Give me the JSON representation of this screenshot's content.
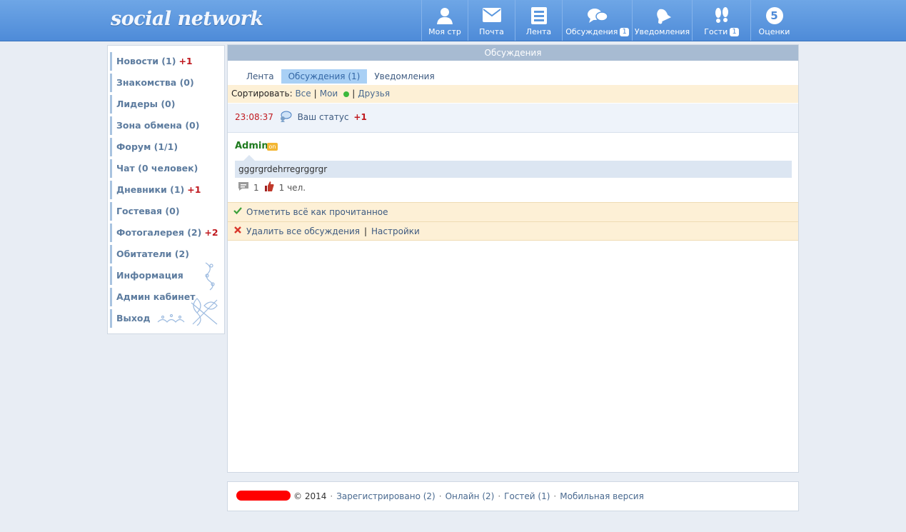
{
  "header": {
    "logo": "social network",
    "nav": [
      {
        "label": "Моя стр",
        "icon": "user-icon"
      },
      {
        "label": "Почта",
        "icon": "mail-icon"
      },
      {
        "label": "Лента",
        "icon": "feed-icon"
      },
      {
        "label": "Обсуждения",
        "icon": "discussions-icon",
        "badge": "1"
      },
      {
        "label": "Уведомления",
        "icon": "bell-icon"
      },
      {
        "label": "Гости",
        "icon": "footprints-icon",
        "badge": "1"
      },
      {
        "label": "Оценки",
        "icon": "rating-icon",
        "score": "5"
      }
    ]
  },
  "sidebar": {
    "items": [
      {
        "label": "Новости (1)",
        "plus": "+1"
      },
      {
        "label": "Знакомства (0)",
        "plus": ""
      },
      {
        "label": "Лидеры (0)",
        "plus": ""
      },
      {
        "label": "Зона обмена (0)",
        "plus": ""
      },
      {
        "label": "Форум (1/1)",
        "plus": ""
      },
      {
        "label": "Чат (0 человек)",
        "plus": ""
      },
      {
        "label": "Дневники (1)",
        "plus": "+1"
      },
      {
        "label": "Гостевая (0)",
        "plus": ""
      },
      {
        "label": "Фотогалерея (2)",
        "plus": "+2"
      },
      {
        "label": "Обитатели (2)",
        "plus": ""
      },
      {
        "label": "Информация",
        "plus": ""
      },
      {
        "label": "Админ кабинет",
        "plus": ""
      },
      {
        "label": "Выход",
        "plus": ""
      }
    ]
  },
  "main": {
    "title": "Обсуждения",
    "tabs": [
      "Лента",
      "Обсуждения (1)",
      "Уведомления"
    ],
    "sort": {
      "label": "Сортировать:",
      "all": "Все",
      "mine": "Мои",
      "friends": "Друзья"
    },
    "status": {
      "time": "23:08:37",
      "text": "Ваш статус",
      "plus": "+1"
    },
    "post": {
      "author": "Admin",
      "online_badge": "on",
      "message": "gggrgrdehrregrggrgr",
      "comments": "1",
      "likes": "1 чел."
    },
    "actions": {
      "mark_read": "Отметить всё как прочитанное",
      "delete_all": "Удалить все обсуждения",
      "settings": "Настройки"
    }
  },
  "footer": {
    "copyright": "© 2014",
    "registered": "Зарегистрировано (2)",
    "online": "Онлайн (2)",
    "guests": "Гостей (1)",
    "mobile": "Мобильная версия"
  }
}
